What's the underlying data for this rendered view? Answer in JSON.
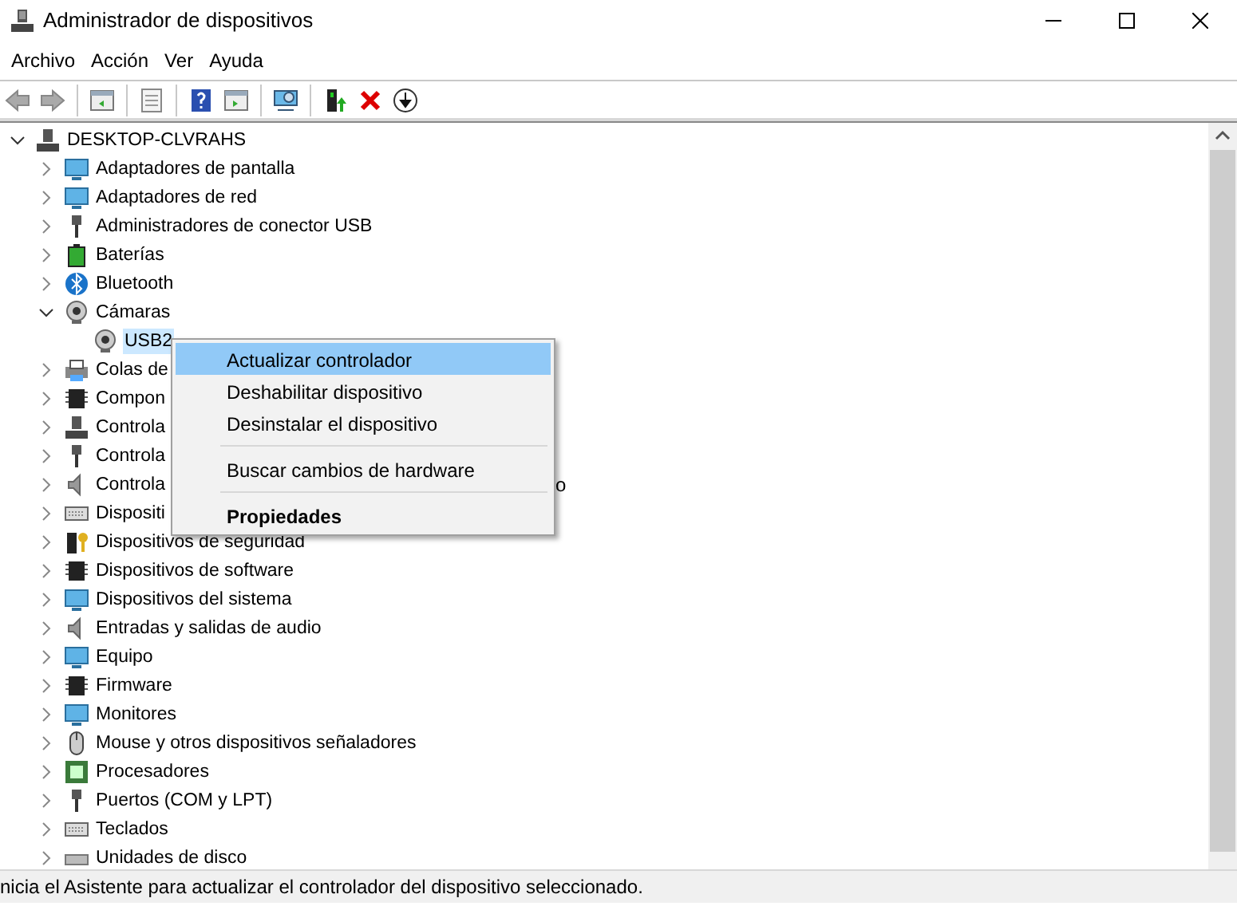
{
  "window": {
    "title": "Administrador de dispositivos"
  },
  "menu_bar": [
    "Archivo",
    "Acción",
    "Ver",
    "Ayuda"
  ],
  "tree": {
    "label": "DESKTOP-CLVRAHS",
    "expanded": true,
    "children": [
      {
        "label": "Adaptadores de pantalla",
        "expanded": false
      },
      {
        "label": "Adaptadores de red",
        "expanded": false
      },
      {
        "label": "Administradores de conector USB",
        "expanded": false
      },
      {
        "label": "Baterías",
        "expanded": false
      },
      {
        "label": "Bluetooth",
        "expanded": false
      },
      {
        "label": "Cámaras",
        "expanded": true,
        "children": [
          {
            "label": "USB2",
            "selected": true
          }
        ]
      },
      {
        "label": "Colas de",
        "expanded": false
      },
      {
        "label": "Compon",
        "expanded": false
      },
      {
        "label": "Controla",
        "expanded": false
      },
      {
        "label": "Controla",
        "expanded": false
      },
      {
        "label": "Controla",
        "label_tail": "o",
        "expanded": false
      },
      {
        "label": "Dispositi",
        "expanded": false
      },
      {
        "label": "Dispositivos de seguridad",
        "expanded": false
      },
      {
        "label": "Dispositivos de software",
        "expanded": false
      },
      {
        "label": "Dispositivos del sistema",
        "expanded": false
      },
      {
        "label": "Entradas y salidas de audio",
        "expanded": false
      },
      {
        "label": "Equipo",
        "expanded": false
      },
      {
        "label": "Firmware",
        "expanded": false
      },
      {
        "label": "Monitores",
        "expanded": false
      },
      {
        "label": "Mouse y otros dispositivos señaladores",
        "expanded": false
      },
      {
        "label": "Procesadores",
        "expanded": false
      },
      {
        "label": "Puertos (COM y LPT)",
        "expanded": false
      },
      {
        "label": "Teclados",
        "expanded": false
      },
      {
        "label": "Unidades de disco",
        "expanded": false
      }
    ]
  },
  "context_menu": [
    {
      "kind": "item",
      "label": "Actualizar controlador",
      "selected": true,
      "bold": false
    },
    {
      "kind": "item",
      "label": "Deshabilitar dispositivo",
      "selected": false,
      "bold": false
    },
    {
      "kind": "item",
      "label": "Desinstalar el dispositivo",
      "selected": false,
      "bold": false
    },
    {
      "kind": "separator"
    },
    {
      "kind": "item",
      "label": "Buscar cambios de hardware",
      "selected": false,
      "bold": false
    },
    {
      "kind": "separator"
    },
    {
      "kind": "item",
      "label": "Propiedades",
      "selected": false,
      "bold": true
    }
  ],
  "status_bar": "nicia el Asistente para actualizar el controlador del dispositivo seleccionado."
}
